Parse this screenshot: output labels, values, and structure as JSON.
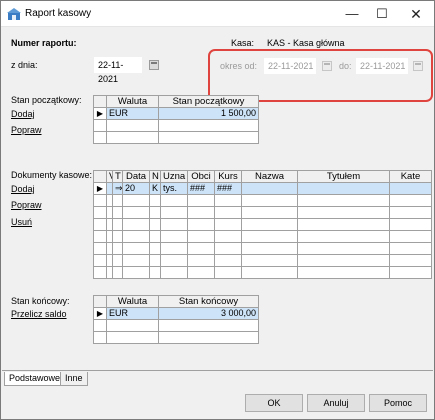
{
  "window": {
    "title": "Raport kasowy",
    "minimize": "—",
    "maximize": "☐",
    "close": "✕"
  },
  "header": {
    "report_number_label": "Numer raportu:",
    "date_label": "z dnia:",
    "date_value": "22-11-2021",
    "kasa_label": "Kasa:",
    "kasa_value": "KAS - Kasa główna",
    "period_from_label": "okres od:",
    "period_from_value": "22-11-2021",
    "period_to_label": "do:",
    "period_to_value": "22-11-2021"
  },
  "opening": {
    "label": "Stan początkowy:",
    "add_link": "Dodaj",
    "edit_link": "Popraw",
    "columns": [
      "Waluta",
      "Stan początkowy"
    ],
    "rows": [
      {
        "currency": "EUR",
        "amount": "1 500,00"
      }
    ]
  },
  "documents": {
    "label": "Dokumenty kasowe:",
    "add_link": "Dodaj",
    "edit_link": "Popraw",
    "delete_link": "Usuń",
    "columns": [
      "V",
      "T",
      "Data",
      "N",
      "Uzna",
      "Obci",
      "Kurs",
      "Nazwa",
      "Tytułem",
      "Kate"
    ],
    "rows": [
      {
        "t": "⇒",
        "data": "20",
        "n": "K",
        "uzna": "tys.",
        "obci": "###",
        "kurs": "###"
      }
    ]
  },
  "closing": {
    "label": "Stan końcowy:",
    "recalc_link": "Przelicz saldo",
    "columns": [
      "Waluta",
      "Stan końcowy"
    ],
    "rows": [
      {
        "currency": "EUR",
        "amount": "3 000,00"
      }
    ]
  },
  "tabs": [
    "Podstawowe",
    "Inne"
  ],
  "buttons": {
    "ok": "OK",
    "cancel": "Anuluj",
    "help": "Pomoc"
  },
  "colors": {
    "selection": "#cde3f7",
    "highlight_border": "#e0443e",
    "row_indicator": "#000000"
  },
  "icons": {
    "app": "cash-register-icon",
    "calendar": "calendar-icon",
    "row_pointer": "row-pointer-icon"
  }
}
